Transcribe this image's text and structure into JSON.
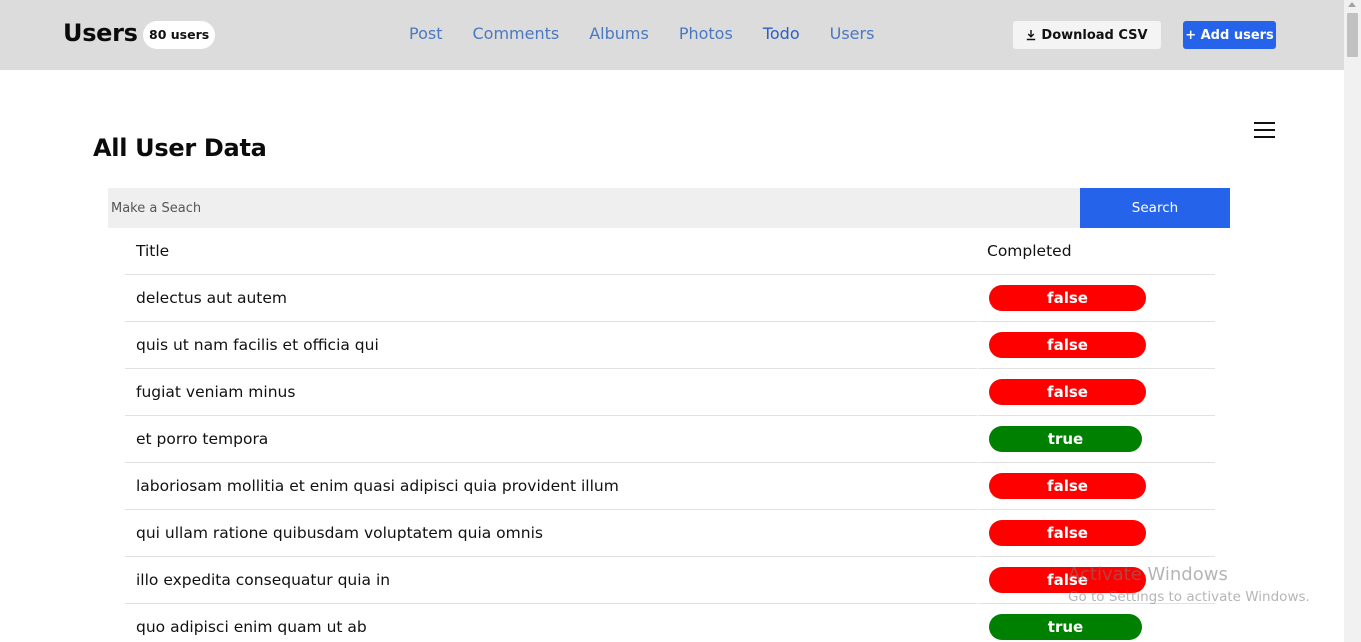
{
  "header": {
    "brand": "Users",
    "count_badge": "80 users",
    "nav": [
      "Post",
      "Comments",
      "Albums",
      "Photos",
      "Todo",
      "Users"
    ],
    "download_label": "Download CSV",
    "add_label": "+ Add users"
  },
  "main": {
    "page_title": "All User Data",
    "search_placeholder": "Make a Seach",
    "search_button": "Search"
  },
  "table": {
    "columns": [
      "Title",
      "Completed"
    ],
    "rows": [
      {
        "title": "delectus aut autem",
        "completed": "false"
      },
      {
        "title": "quis ut nam facilis et officia qui",
        "completed": "false"
      },
      {
        "title": "fugiat veniam minus",
        "completed": "false"
      },
      {
        "title": "et porro tempora",
        "completed": "true"
      },
      {
        "title": "laboriosam mollitia et enim quasi adipisci quia provident illum",
        "completed": "false"
      },
      {
        "title": "qui ullam ratione quibusdam voluptatem quia omnis",
        "completed": "false"
      },
      {
        "title": "illo expedita consequatur quia in",
        "completed": "false"
      },
      {
        "title": "quo adipisci enim quam ut ab",
        "completed": "true"
      }
    ]
  },
  "colors": {
    "accent": "#2563eb",
    "status_false": "#ff0000",
    "status_true": "#008000",
    "nav_link": "#4a78c2",
    "header_bg": "#dcdcdc"
  },
  "icons": {
    "download": "download-icon",
    "menu": "hamburger-menu-icon"
  },
  "watermark": {
    "title": "Activate Windows",
    "subtitle": "Go to Settings to activate Windows."
  }
}
